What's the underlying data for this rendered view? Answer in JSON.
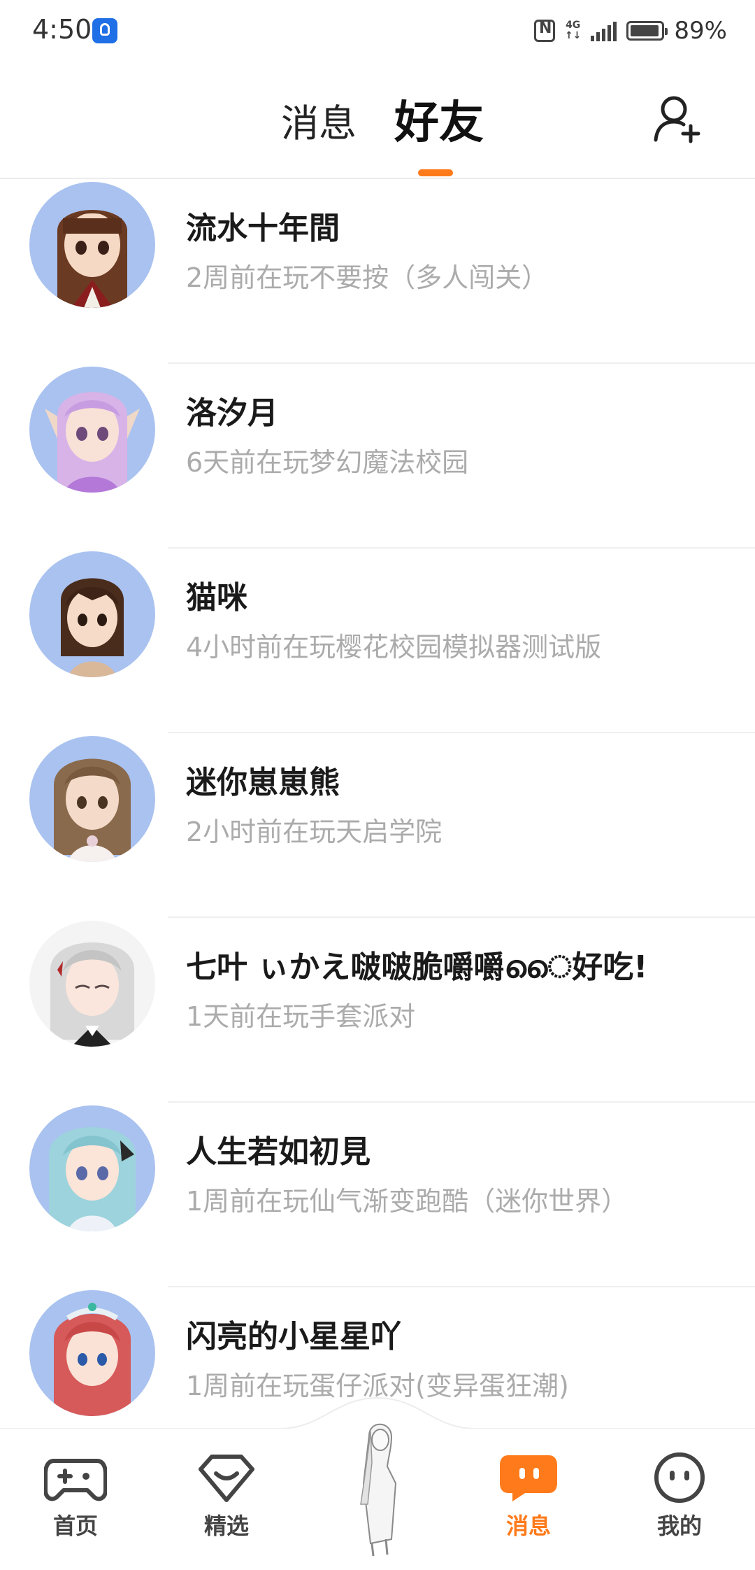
{
  "status_bar": {
    "time": "4:50",
    "network": "4G",
    "battery": "89%"
  },
  "header": {
    "tabs": [
      {
        "label": "消息",
        "active": false
      },
      {
        "label": "好友",
        "active": true
      }
    ],
    "accent_color": "#ff7a1a",
    "add_friend_icon": "add-user-icon"
  },
  "friends": [
    {
      "name": "流水十年間",
      "status": "2周前在玩不要按（多人闯关）"
    },
    {
      "name": "洛汐月",
      "status": "6天前在玩梦幻魔法校园"
    },
    {
      "name": "猫咪",
      "status": "4小时前在玩樱花校园模拟器测试版"
    },
    {
      "name": "迷你崽崽熊",
      "status": "2小时前在玩天启学院"
    },
    {
      "name": "七叶 ぃかえ啵啵脆嚼嚼ൈ好吃!",
      "status": "1天前在玩手套派对"
    },
    {
      "name": "人生若如初見",
      "status": "1周前在玩仙气渐变跑酷（迷你世界）"
    },
    {
      "name": "闪亮的小星星吖",
      "status": "1周前在玩蛋仔派对(变异蛋狂潮)"
    }
  ],
  "bottom_nav": {
    "items": [
      {
        "label": "首页",
        "icon": "gamepad-icon",
        "active": false
      },
      {
        "label": "精选",
        "icon": "heart-gem-icon",
        "active": false
      },
      {
        "label": "消息",
        "icon": "message-bubble-icon",
        "active": true
      },
      {
        "label": "我的",
        "icon": "smiley-face-icon",
        "active": false
      }
    ],
    "center_icon": "character-avatar-icon"
  }
}
